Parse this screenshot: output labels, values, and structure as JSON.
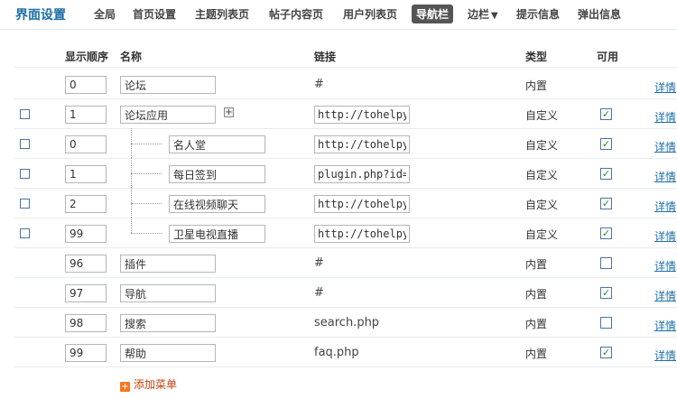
{
  "page_title": "界面设置",
  "tabs": [
    {
      "label": "全局"
    },
    {
      "label": "首页设置"
    },
    {
      "label": "主题列表页"
    },
    {
      "label": "帖子内容页"
    },
    {
      "label": "用户列表页"
    },
    {
      "label": "导航栏",
      "active": true
    },
    {
      "label": "边栏",
      "dropdown": true
    },
    {
      "label": "提示信息"
    },
    {
      "label": "弹出信息"
    }
  ],
  "headers": {
    "order": "显示顺序",
    "name": "名称",
    "link": "链接",
    "type": "类型",
    "available": "可用"
  },
  "rows": [
    {
      "order": "0",
      "name": "论坛",
      "link": "#",
      "link_editable": false,
      "type": "内置",
      "available": null,
      "checkbox": false,
      "level": 0,
      "detail": "详情"
    },
    {
      "order": "1",
      "name": "论坛应用",
      "link": "http://tohelpyou",
      "link_editable": true,
      "type": "自定义",
      "available": true,
      "checkbox": true,
      "level": 0,
      "expand": true,
      "detail": "详情"
    },
    {
      "order": "0",
      "name": "名人堂",
      "link": "http://tohelpyou",
      "link_editable": true,
      "type": "自定义",
      "available": true,
      "checkbox": true,
      "level": 1,
      "detail": "详情"
    },
    {
      "order": "1",
      "name": "每日签到",
      "link": "plugin.php?id=d",
      "link_editable": true,
      "type": "自定义",
      "available": true,
      "checkbox": true,
      "level": 1,
      "detail": "详情"
    },
    {
      "order": "2",
      "name": "在线视频聊天",
      "link": "http://tohelpyou",
      "link_editable": true,
      "type": "自定义",
      "available": true,
      "checkbox": true,
      "level": 1,
      "detail": "详情"
    },
    {
      "order": "99",
      "name": "卫星电视直播",
      "link": "http://tohelpyou",
      "link_editable": true,
      "type": "自定义",
      "available": true,
      "checkbox": true,
      "level": 1,
      "last_child": true,
      "detail": "详情"
    },
    {
      "order": "96",
      "name": "插件",
      "link": "#",
      "link_editable": false,
      "type": "内置",
      "available": false,
      "checkbox": false,
      "level": 0,
      "detail": "详情"
    },
    {
      "order": "97",
      "name": "导航",
      "link": "#",
      "link_editable": false,
      "type": "内置",
      "available": true,
      "checkbox": false,
      "level": 0,
      "detail": "详情"
    },
    {
      "order": "98",
      "name": "搜索",
      "link": "search.php",
      "link_editable": false,
      "type": "内置",
      "available": false,
      "checkbox": false,
      "level": 0,
      "detail": "详情"
    },
    {
      "order": "99",
      "name": "帮助",
      "link": "faq.php",
      "link_editable": false,
      "type": "内置",
      "available": true,
      "checkbox": false,
      "level": 0,
      "detail": "详情"
    }
  ],
  "add_menu_label": "添加菜单",
  "colors": {
    "accent": "#1e6ea7",
    "active_tab_bg": "#555555",
    "add_icon": "#f07a22"
  },
  "icons": {
    "expand": "plus-square-icon",
    "add": "plus-icon"
  }
}
